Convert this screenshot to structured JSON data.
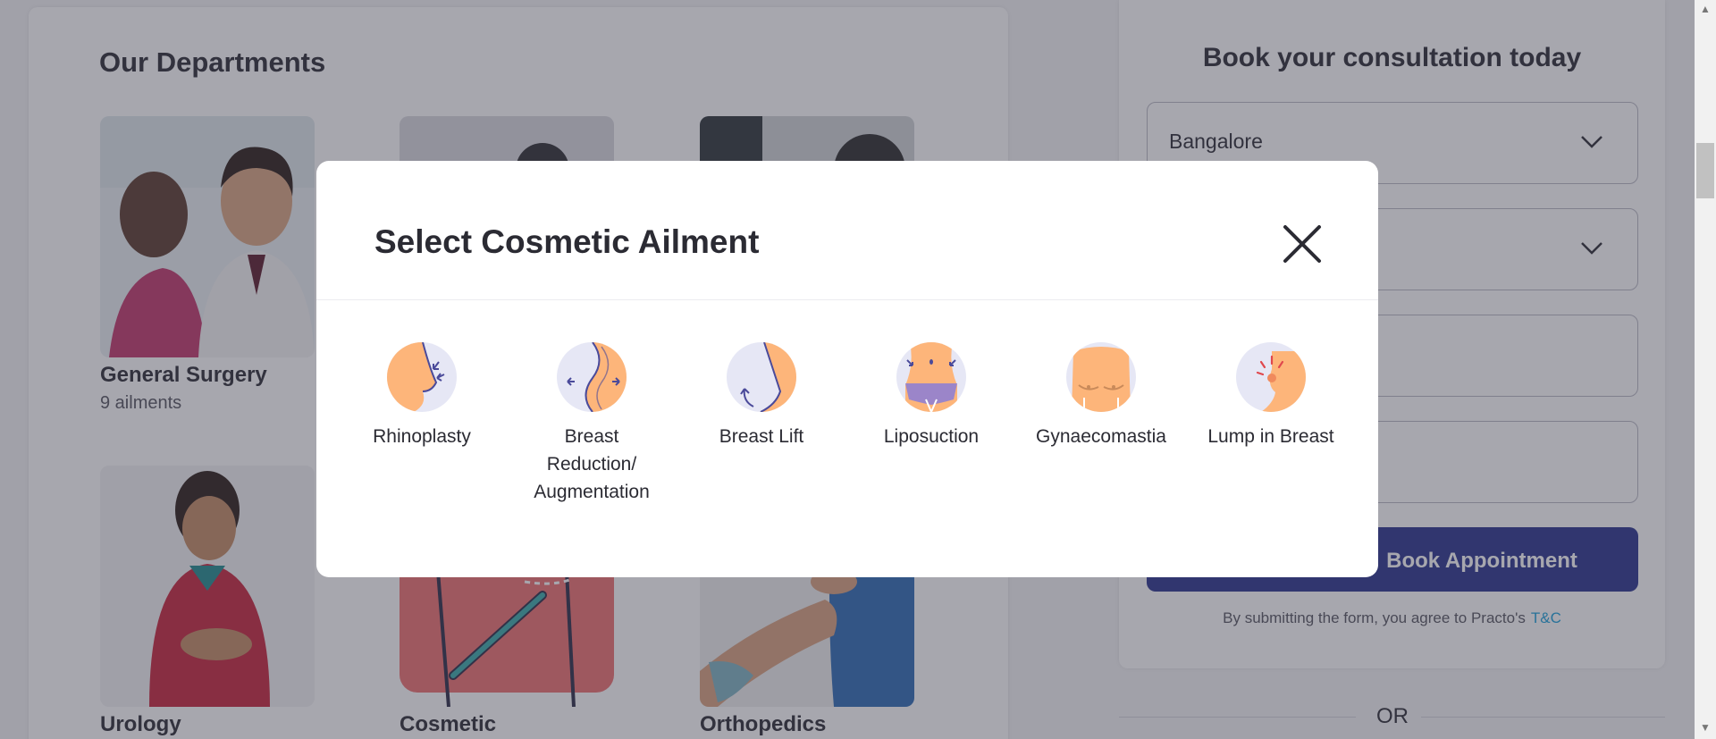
{
  "departments": {
    "title": "Our Departments",
    "items": [
      {
        "name": "General Surgery",
        "count": "9 ailments"
      },
      {
        "name": "Urology",
        "count": ""
      },
      {
        "name": "Cosmetic",
        "count": ""
      },
      {
        "name": "Orthopedics",
        "count": ""
      }
    ]
  },
  "booking": {
    "title": "Book your consultation today",
    "city_value": "Bangalore",
    "submit_label": "Book Appointment",
    "terms_text": "By submitting the form, you agree to Practo's",
    "terms_link": "T&C",
    "or_text": "OR"
  },
  "modal": {
    "title": "Select Cosmetic Ailment",
    "ailments": [
      {
        "label": "Rhinoplasty",
        "icon": "nose-icon"
      },
      {
        "label": "Breast Reduction/ Augmentation",
        "icon": "breast-augmentation-icon"
      },
      {
        "label": "Breast Lift",
        "icon": "breast-lift-icon"
      },
      {
        "label": "Liposuction",
        "icon": "liposuction-icon"
      },
      {
        "label": "Gynaecomastia",
        "icon": "male-chest-icon"
      },
      {
        "label": "Lump in Breast",
        "icon": "breast-lump-icon"
      }
    ]
  },
  "colors": {
    "primary_button": "#28328c",
    "link": "#199fd9",
    "icon_skin": "#fdb57a",
    "icon_bg": "#e6e7f5",
    "icon_stroke": "#4a4a9a"
  }
}
